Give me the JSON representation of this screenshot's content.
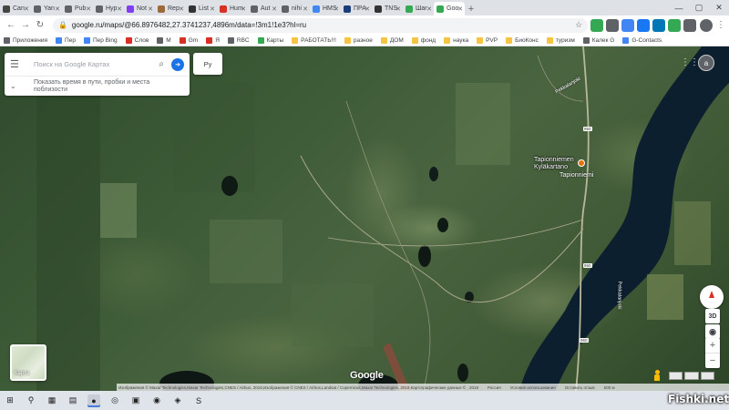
{
  "browser": {
    "tabs": [
      {
        "label": "Can",
        "color": "#444444"
      },
      {
        "label": "Yan",
        "color": "#5f6368"
      },
      {
        "label": "Pub",
        "color": "#5f6368"
      },
      {
        "label": "Hyp",
        "color": "#5f6368"
      },
      {
        "label": "Not",
        "color": "#7e3ff2"
      },
      {
        "label": "Rep",
        "color": "#9c6b3c"
      },
      {
        "label": "List",
        "color": "#333333"
      },
      {
        "label": "Hum",
        "color": "#d93025"
      },
      {
        "label": "Aut",
        "color": "#5f6368"
      },
      {
        "label": "nihi",
        "color": "#5f6368"
      },
      {
        "label": "HMS",
        "color": "#4285f4"
      },
      {
        "label": "ПРА",
        "color": "#1a3d7c"
      },
      {
        "label": "TNS",
        "color": "#333333"
      },
      {
        "label": "Шаг",
        "color": "#34a853"
      },
      {
        "label": "Goo",
        "color": "#34a853",
        "active": true
      }
    ],
    "new_tab": "+",
    "window_controls": [
      "—",
      "▢",
      "✕"
    ],
    "url": "google.ru/maps/@66.8976482,27.3741237,4896m/data=!3m1!1e3?hl=ru",
    "bookmarks": [
      {
        "label": "Приложения",
        "color": "#5f6368"
      },
      {
        "label": "Пер",
        "color": "#4285f4"
      },
      {
        "label": "Пер Bing",
        "color": "#4285f4"
      },
      {
        "label": "Слов",
        "color": "#d93025"
      },
      {
        "label": "M",
        "color": "#5f6368"
      },
      {
        "label": "Gm",
        "color": "#d93025"
      },
      {
        "label": "Я",
        "color": "#d93025"
      },
      {
        "label": "RBC",
        "color": "#5f6368"
      },
      {
        "label": "Карты",
        "color": "#34a853"
      },
      {
        "label": "РАБОТАТЬ!!!",
        "color": "#f6c343"
      },
      {
        "label": "разное",
        "color": "#f6c343"
      },
      {
        "label": "ДОМ",
        "color": "#f6c343"
      },
      {
        "label": "фонд",
        "color": "#f6c343"
      },
      {
        "label": "наука",
        "color": "#f6c343"
      },
      {
        "label": "PVP",
        "color": "#f6c343"
      },
      {
        "label": "БиоКонс",
        "color": "#f6c343"
      },
      {
        "label": "туризм",
        "color": "#f6c343"
      },
      {
        "label": "Калек G",
        "color": "#5f6368"
      },
      {
        "label": "G-Contacts",
        "color": "#4285f4"
      }
    ]
  },
  "maps": {
    "search_placeholder": "Поиск на Google Картах",
    "hint": "Показать время в пути, пробки и места поблизости",
    "language": "Ру",
    "account_initial": "a",
    "place_name_line1": "Tapionniemen",
    "place_name_line2": "Kyläkartano",
    "place_name_small": "Tapionniemi",
    "river_label": "Pekkalanjoki",
    "road_shields": [
      "950",
      "950",
      "950"
    ],
    "layer_label": "Карта",
    "tilt_label": "3D",
    "logo": "Google",
    "attribution": [
      "Изображения © Maxar Technologies,Maxar Technologies,CNES / Airbus, 2019,Изображения © CNES / Airbus,Landsat / Copernicus,Maxar Technologies, 2019,Картографические данные © , 2019",
      "Россия",
      "Условия использования",
      "Оставить отзыв",
      "500 м"
    ]
  },
  "taskbar": {
    "icons": [
      "⊞",
      "⚲",
      "▦",
      "▤",
      "●",
      "◎",
      "▣",
      "◉",
      "◈",
      "S"
    ],
    "tray": [
      "^",
      "ENG"
    ]
  },
  "watermark": "Fishki.net",
  "colors": {
    "accent": "#1a73e8",
    "pin": "#e8710a"
  }
}
